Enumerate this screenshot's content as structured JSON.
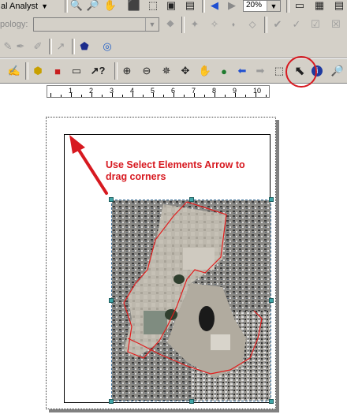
{
  "toolbar_top": {
    "analyst_menu": "al Analyst",
    "analyst_menu_arrow": "▼",
    "zoom_value": "20%"
  },
  "toolbar_topology": {
    "label": "pology:",
    "layer_value": ""
  },
  "toolbar_layout": {
    "tools": [
      "zoom-in-icon",
      "zoom-out-icon",
      "fixed-zoom-in-icon",
      "fixed-zoom-out-icon",
      "pan-icon",
      "full-extent-icon",
      "back-icon",
      "forward-icon",
      "select-features-icon",
      "select-elements-icon",
      "identify-icon",
      "find-icon"
    ]
  },
  "ruler": {
    "labels": [
      "1",
      "2",
      "3",
      "4",
      "5",
      "6",
      "7",
      "8",
      "9",
      "10"
    ]
  },
  "annotation": {
    "text_line1": "Use Select Elements Arrow to",
    "text_line2": "drag corners",
    "color": "#d71920"
  },
  "colors": {
    "toolbar_bg": "#d4d0c8",
    "handle": "#41a6a8",
    "parcel_outline": "#e11d1d"
  }
}
